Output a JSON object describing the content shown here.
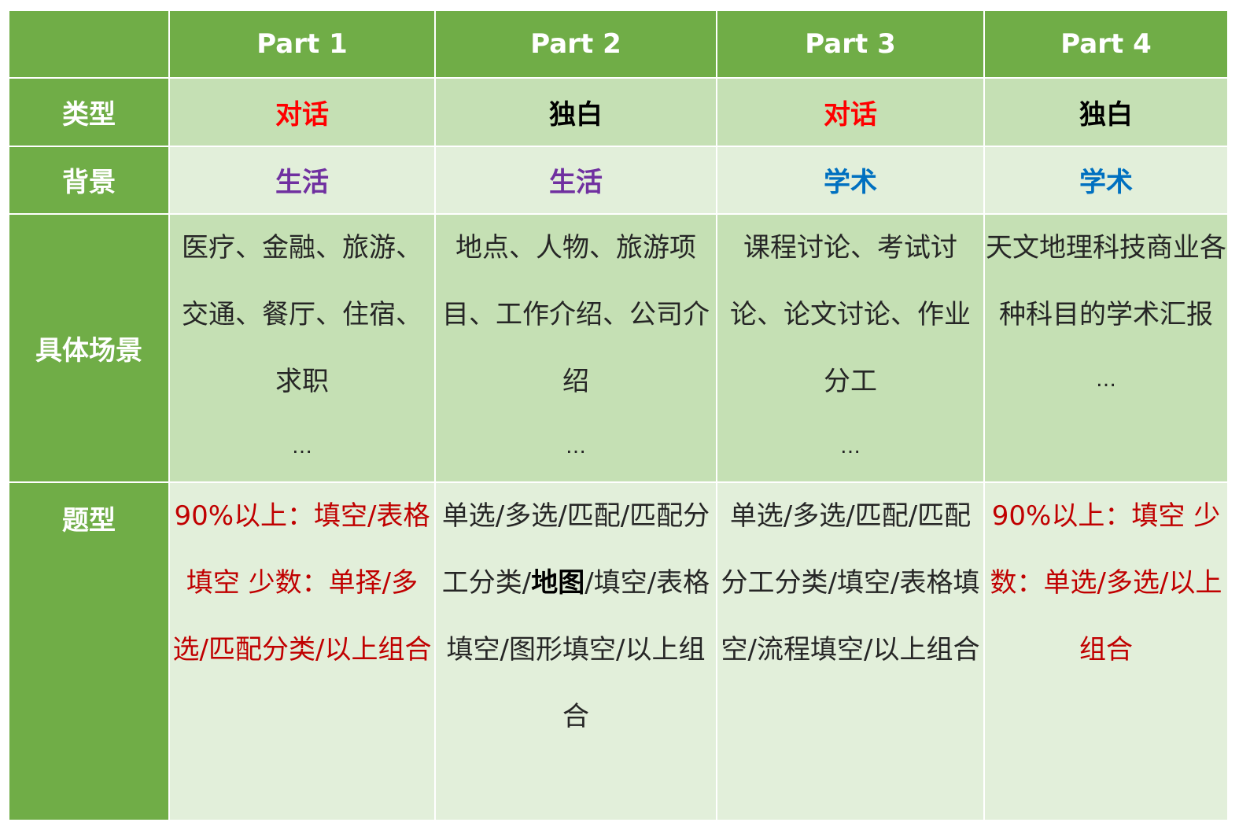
{
  "header": {
    "parts": [
      "Part 1",
      "Part 2",
      "Part 3",
      "Part 4"
    ]
  },
  "row_labels": {
    "type": "类型",
    "background": "背景",
    "scene": "具体场景",
    "question_type": "题型"
  },
  "type_row": [
    "对话",
    "独白",
    "对话",
    "独白"
  ],
  "background_row": [
    "生活",
    "生活",
    "学术",
    "学术"
  ],
  "scene_row": [
    {
      "text": "医疗、金融、旅游、交通、餐厅、住宿、求职",
      "more": "…"
    },
    {
      "text": "地点、人物、旅游项目、工作介绍、公司介绍",
      "more": "…"
    },
    {
      "text": "课程讨论、考试讨论、论文讨论、作业分工",
      "more": "…"
    },
    {
      "text": "天文地理科技商业各种科目的学术汇报",
      "more": "…"
    }
  ],
  "question_type_row": {
    "part1": {
      "line1": "90%以上：填空/表格填空",
      "line2": "少数：单择/多选/匹配分类/以上组合"
    },
    "part2": {
      "before": "单选/多选/匹配/匹配分工分类/",
      "bold": "地图",
      "after": "/填空/表格填空/图形填空/以上组合"
    },
    "part3": {
      "text": "单选/多选/匹配/匹配分工分类/填空/表格填空/流程填空/以上组合"
    },
    "part4": {
      "line1": "90%以上：填空",
      "line2": "少数：单选/多选/以上组合"
    }
  },
  "colors": {
    "header_green": "#70ad47",
    "row_dark": "#c5e0b4",
    "row_light": "#e2efda",
    "red": "#ff0000",
    "dark_red": "#c00000",
    "purple": "#7030a0",
    "blue": "#0070c0"
  }
}
